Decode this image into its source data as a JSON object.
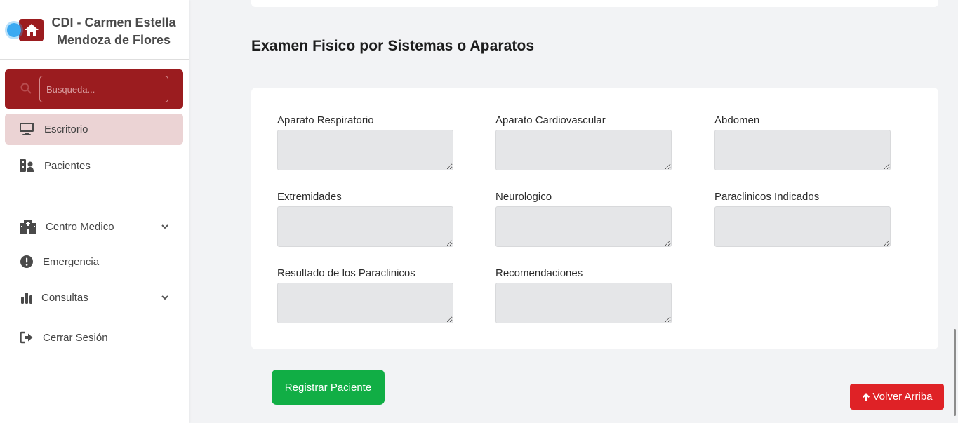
{
  "sidebar": {
    "brand_title": "CDI - Carmen Estella Mendoza de Flores",
    "search_placeholder": "Busqueda...",
    "items": [
      {
        "label": "Escritorio",
        "icon": "monitor-icon"
      },
      {
        "label": "Pacientes",
        "icon": "patients-icon"
      },
      {
        "label": "Centro Medico",
        "icon": "hospital-icon"
      },
      {
        "label": "Emergencia",
        "icon": "exclamation-icon"
      },
      {
        "label": "Consultas",
        "icon": "bar-chart-icon"
      },
      {
        "label": "Cerrar Sesión",
        "icon": "sign-out-icon"
      }
    ]
  },
  "main": {
    "section_title": "Examen Fisico por Sistemas o Aparatos",
    "fields": [
      {
        "label": "Aparato Respiratorio",
        "value": ""
      },
      {
        "label": "Aparato Cardiovascular",
        "value": ""
      },
      {
        "label": "Abdomen",
        "value": ""
      },
      {
        "label": "Extremidades",
        "value": ""
      },
      {
        "label": "Neurologico",
        "value": ""
      },
      {
        "label": "Paraclinicos Indicados",
        "value": ""
      },
      {
        "label": "Resultado de los Paraclinicos",
        "value": ""
      },
      {
        "label": "Recomendaciones",
        "value": ""
      }
    ],
    "submit_label": "Registrar Paciente",
    "back_to_top_label": "Volver Arriba"
  },
  "colors": {
    "brand": "#9b1c1f",
    "active_nav": "#ebd3d4",
    "submit": "#11ae45",
    "back_to_top": "#df2226"
  }
}
